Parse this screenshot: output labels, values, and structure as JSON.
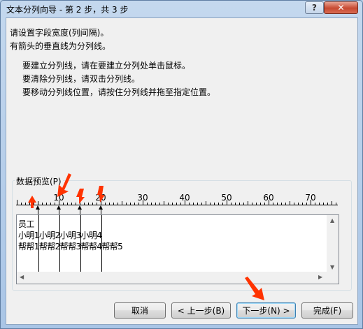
{
  "window": {
    "title": "文本分列向导 - 第 2 步，共 3 步",
    "help_label": "?",
    "close_label": "✕"
  },
  "instructions": {
    "line1": "请设置字段宽度(列间隔)。",
    "line2": "有箭头的垂直线为分列线。",
    "bullet1": "要建立分列线，请在要建立分列处单击鼠标。",
    "bullet2": "要清除分列线，请双击分列线。",
    "bullet3": "要移动分列线位置，请按住分列线并拖至指定位置。"
  },
  "preview": {
    "label": "数据预览(P)",
    "ruler_numbers": [
      "10",
      "20",
      "30",
      "40",
      "50",
      "60",
      "70"
    ],
    "rows": [
      "员工",
      "小明1小明2小明3小明4",
      "帮帮1帮帮2帮帮3帮帮4帮帮5"
    ]
  },
  "buttons": {
    "cancel": "取消",
    "back": "< 上一步(B)",
    "next": "下一步(N) >",
    "finish": "完成(F)"
  },
  "colors": {
    "annotation_arrow": "#ff3300",
    "title_bar": "#b9d1ea",
    "close_button": "#c74a32"
  }
}
